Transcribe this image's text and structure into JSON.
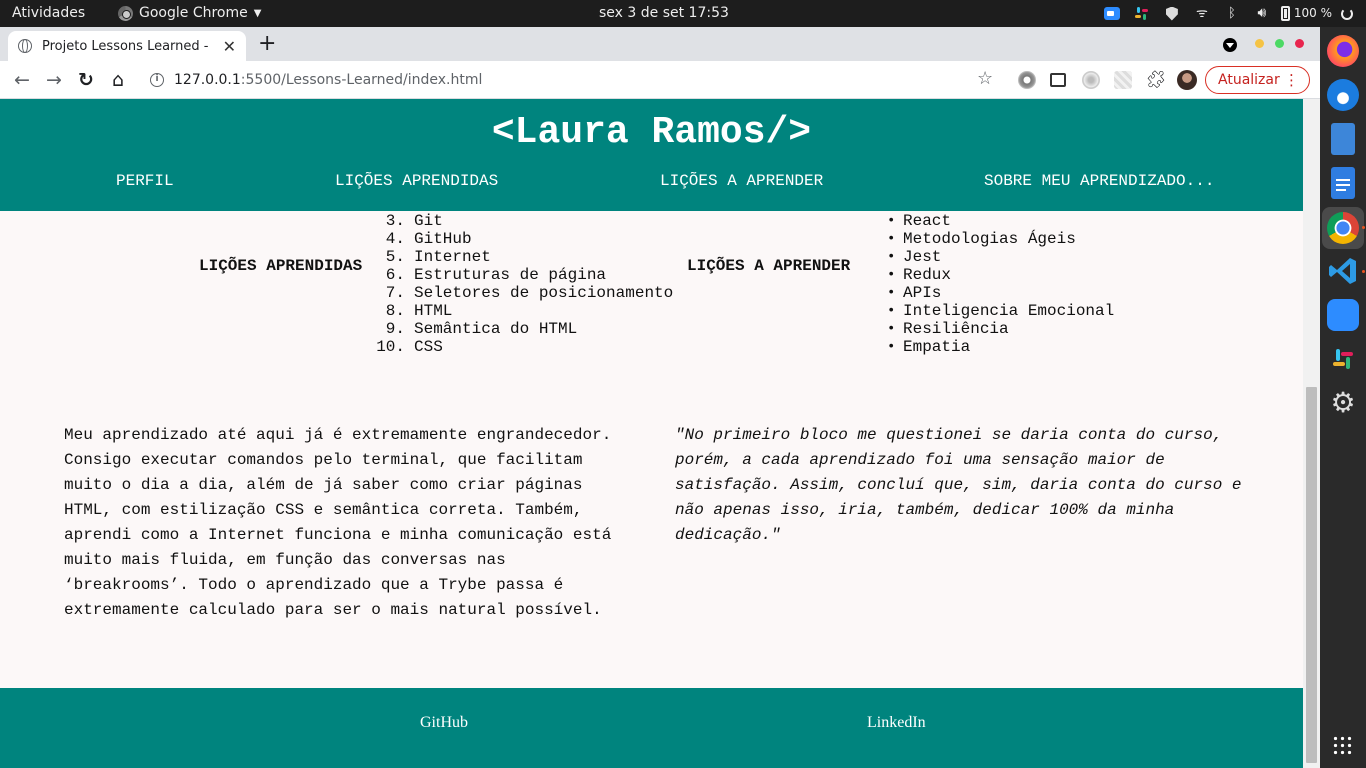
{
  "system": {
    "activities": "Atividades",
    "app_name": "Google Chrome",
    "clock": "sex 3 de set  17:53",
    "battery": "100 %"
  },
  "browser": {
    "tab_title": "Projeto Lessons Learned -",
    "url_host": "127.0.0.1",
    "url_path": ":5500/Lessons-Learned/index.html",
    "update_label": "Atualizar"
  },
  "site": {
    "title": "<Laura Ramos/>",
    "nav": [
      "PERFIL",
      "LIÇÕES APRENDIDAS",
      "LIÇÕES A APRENDER",
      "SOBRE MEU APRENDIZADO..."
    ],
    "learned_label": "LIÇÕES APRENDIDAS",
    "learned_items": [
      {
        "num": "3.",
        "text": "Git"
      },
      {
        "num": "4.",
        "text": "GitHub"
      },
      {
        "num": "5.",
        "text": "Internet"
      },
      {
        "num": "6.",
        "text": "Estruturas de página"
      },
      {
        "num": "7.",
        "text": "Seletores de posicionamento"
      },
      {
        "num": "8.",
        "text": "HTML"
      },
      {
        "num": "9.",
        "text": "Semântica do HTML"
      },
      {
        "num": "10.",
        "text": "CSS"
      }
    ],
    "tolearn_label": "LIÇÕES A APRENDER",
    "tolearn_items": [
      "React",
      "Metodologias Ágeis",
      "Jest",
      "Redux",
      "APIs",
      "Inteligencia Emocional",
      "Resiliência",
      "Empatia"
    ],
    "about": "Meu aprendizado até aqui já é extremamente engrandecedor. Consigo executar comandos pelo terminal, que facilitam muito o dia a dia, além de já saber como criar páginas HTML, com estilização CSS e semântica correta. Também, aprendi como a Internet funciona e minha comunicação está muito mais fluida, em função das conversas nas ‘breakrooms’. Todo o aprendizado que a Trybe passa é extremamente calculado para ser o mais natural possível.",
    "quote": "\"No primeiro bloco me questionei se daria conta do curso, porém, a cada aprendizado foi uma sensação maior de satisfação. Assim, concluí que, sim, daria conta do curso e não apenas isso, iria, também, dedicar 100% da minha dedicação.\"",
    "footer": {
      "github": "GitHub",
      "linkedin": "LinkedIn"
    }
  },
  "colors": {
    "header_bg": "#00847e",
    "page_bg": "#fcf8f8",
    "update_red": "#d93025"
  }
}
